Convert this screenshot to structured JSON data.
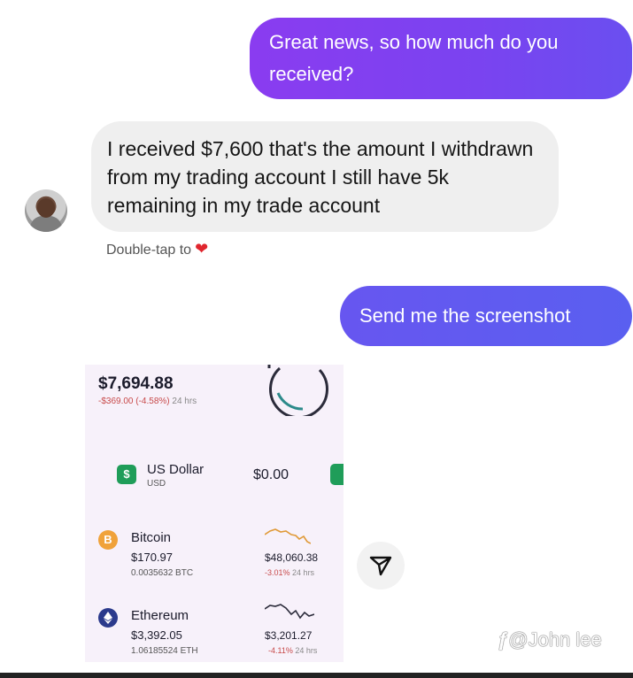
{
  "messages": {
    "msg1": "Great news, so how much do you received?",
    "msg2": "I received $7,600 that's the amount I withdrawn from my trading account I still have 5k remaining in my trade account",
    "hint": "Double-tap to",
    "msg3": "Send me the screenshot"
  },
  "wallet": {
    "total": "$7,694.88",
    "change": "-$369.00 (-4.58%)",
    "change_period": "24 hrs",
    "usd": {
      "name": "US Dollar",
      "sub": "USD",
      "balance": "$0.00",
      "icon": "$"
    },
    "bitcoin": {
      "name": "Bitcoin",
      "value": "$170.97",
      "amount": "0.0035632 BTC",
      "price": "$48,060.38",
      "pct": "-3.01%",
      "period": "24 hrs",
      "icon": "B"
    },
    "ethereum": {
      "name": "Ethereum",
      "value": "$3,392.05",
      "amount": "1.06185524 ETH",
      "price": "$3,201.27",
      "pct": "-4.11%",
      "period": "24 hrs"
    }
  },
  "watermark": "@John lee",
  "colors": {
    "bubble_purple": "#7a43f0",
    "bubble_blue": "#5a5ff0",
    "heart": "#e0262e",
    "usd_green": "#1f9d59",
    "btc_orange": "#f0a23a",
    "eth_navy": "#2b3a8c",
    "loss_red": "#c84a4a"
  },
  "icons": {
    "heart": "heart-icon",
    "send": "send-icon",
    "avatar": "avatar"
  }
}
